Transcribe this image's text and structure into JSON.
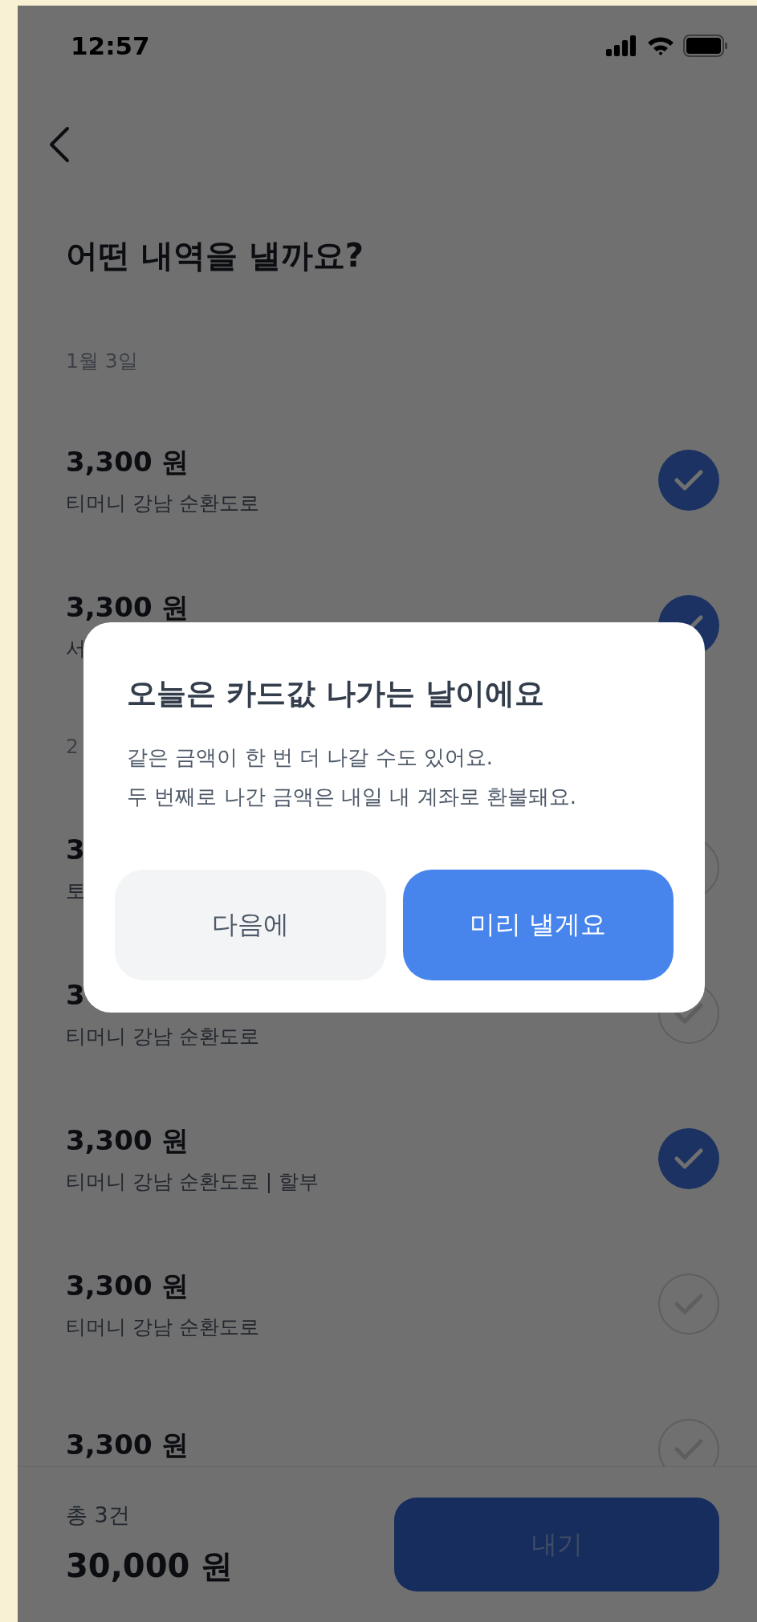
{
  "status_bar": {
    "time": "12:57"
  },
  "title": "어떤 내역을 낼까요?",
  "sections": [
    {
      "date": "1월 3일",
      "items": [
        {
          "amount": "3,300 원",
          "detail": "티머니 강남 순환도로",
          "checked": true
        },
        {
          "amount": "3,300 원",
          "detail": "서",
          "checked": true
        }
      ]
    },
    {
      "date": "2",
      "items": [
        {
          "amount": "3",
          "detail": "토",
          "checked": false
        },
        {
          "amount": "3",
          "detail": "티머니 강남 순환도로",
          "checked": false
        },
        {
          "amount": "3,300 원",
          "detail": "티머니 강남 순환도로 | 할부",
          "checked": true
        },
        {
          "amount": "3,300 원",
          "detail": "티머니 강남 순환도로",
          "checked": false
        },
        {
          "amount": "3,300 원",
          "checked": false
        }
      ]
    }
  ],
  "footer": {
    "count": "총 3건",
    "total": "30,000 원",
    "button": "내기"
  },
  "dialog": {
    "title": "오늘은 카드값 나가는 날이에요",
    "body": [
      "같은 금액이 한 번 더 나갈 수도 있어요.",
      "두 번째로 나간 금액은 내일 내 계좌로 환불돼요."
    ],
    "buttons": [
      {
        "label": "다음에",
        "kind": "secondary"
      },
      {
        "label": "미리 낼게요",
        "kind": "primary"
      }
    ]
  }
}
